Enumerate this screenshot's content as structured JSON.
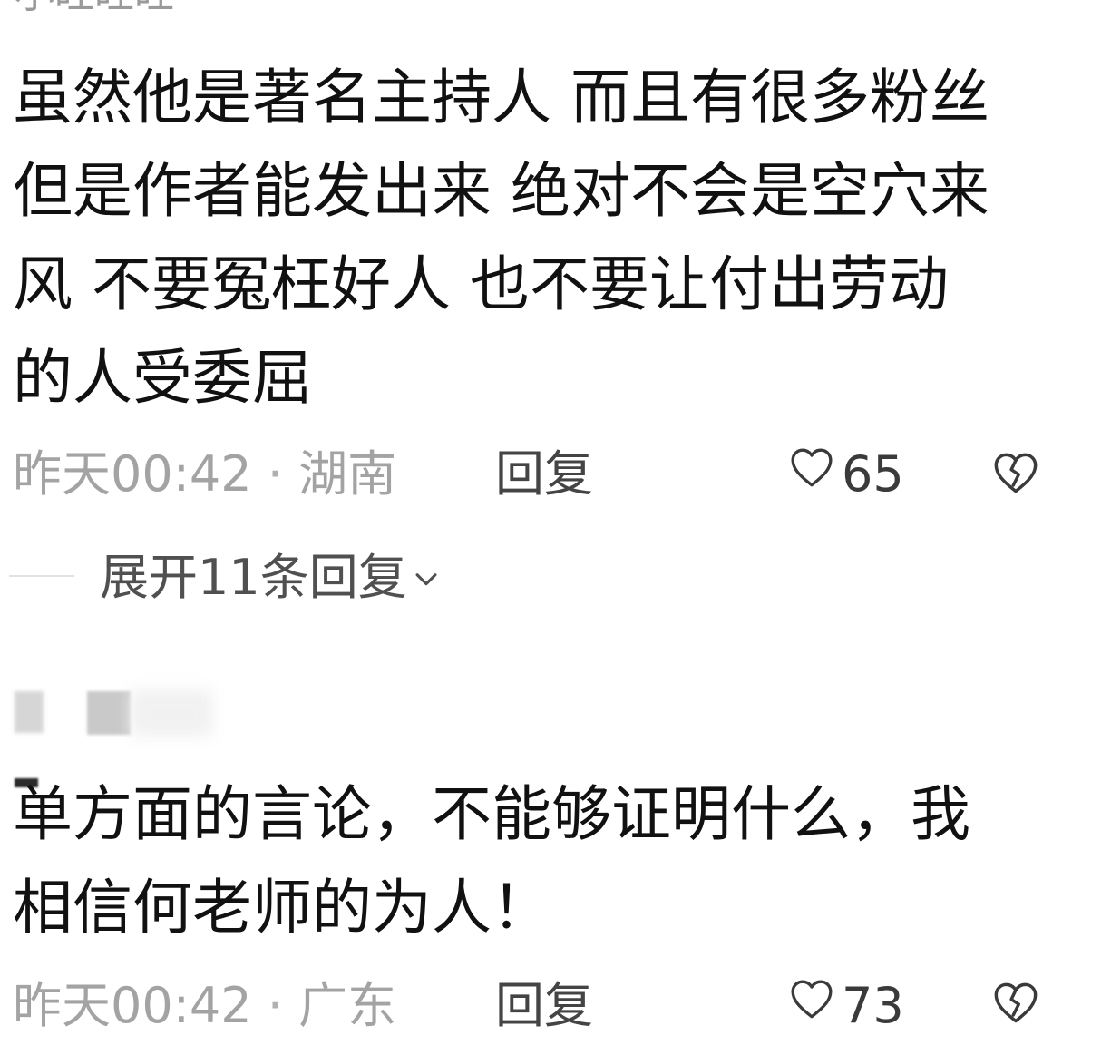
{
  "top_username": "小旺旺旺",
  "comments": [
    {
      "text_lines": [
        "虽然他是著名主持人 而且有很多粉丝",
        "但是作者能发出来 绝对不会是空穴来",
        "风 不要冤枉好人 也不要让付出劳动",
        "的人受委屈"
      ],
      "time": "昨天00:42",
      "separator": "·",
      "location": "湖南",
      "reply_label": "回复",
      "likes": "65"
    },
    {
      "text_lines": [
        "单方面的言论，不能够证明什么，我",
        "相信何老师的为人！"
      ],
      "time": "昨天00:42",
      "separator": "·",
      "location": "广东",
      "reply_label": "回复",
      "likes": "73"
    }
  ],
  "expand_replies_label": "展开11条回复",
  "icons": {
    "like": "heart-outline-icon",
    "dislike": "broken-heart-icon",
    "expand": "chevron-down-icon"
  },
  "colors": {
    "text": "#111111",
    "meta": "#a3a3a3",
    "action": "#444444"
  }
}
